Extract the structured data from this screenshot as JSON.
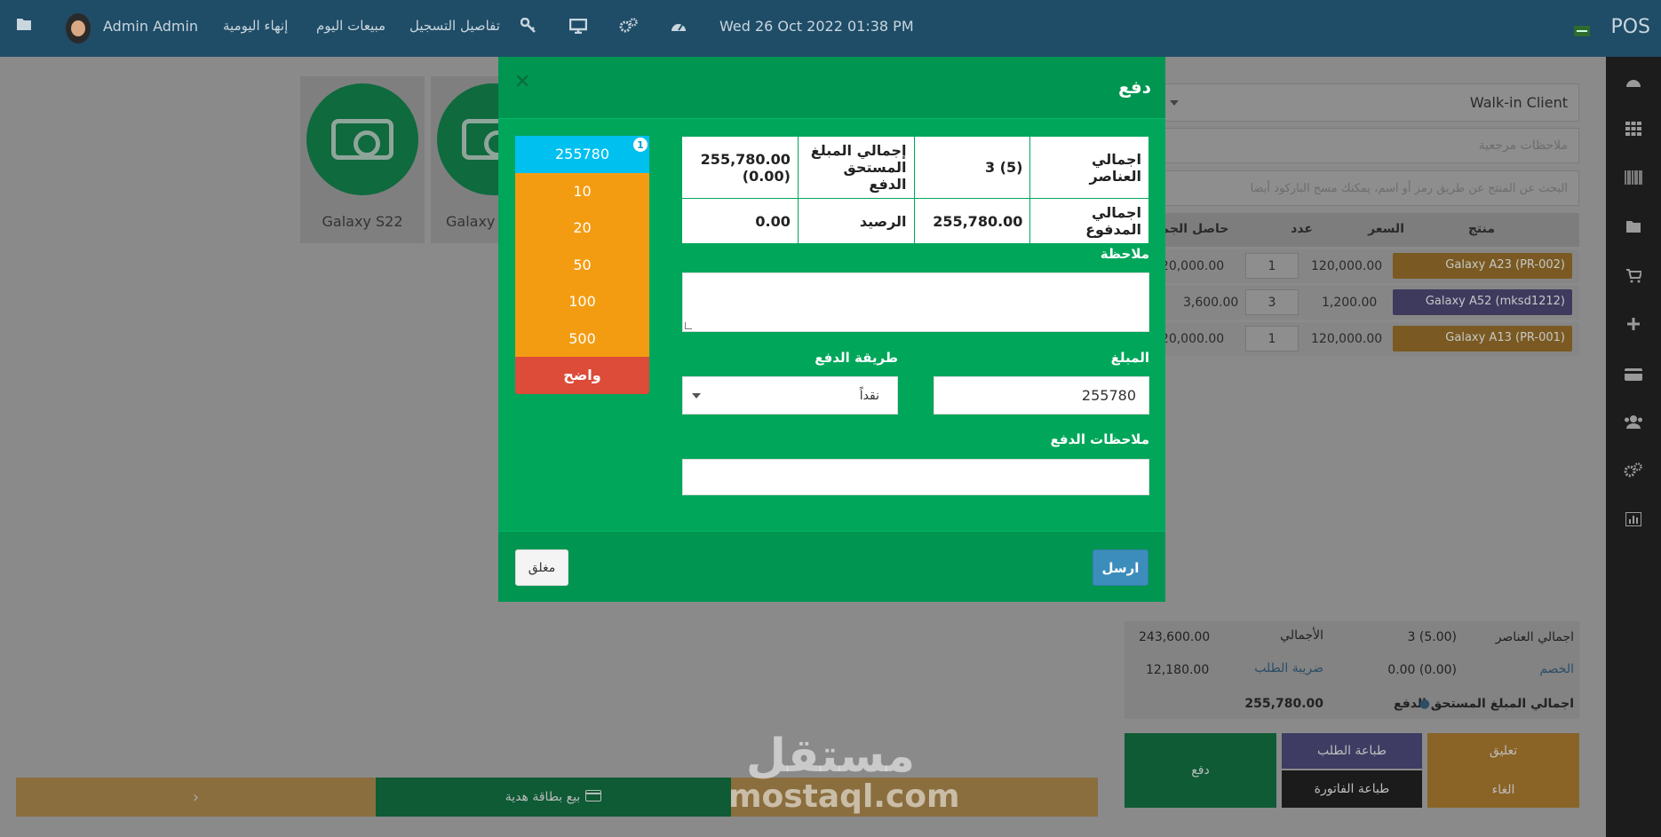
{
  "topbar": {
    "user_name": "Admin Admin",
    "end_of_day": "إنهاء اليومية",
    "today_sales": "مبيعات اليوم",
    "register_details": "تفاصيل التسجيل",
    "datetime": "Wed 26 Oct 2022 01:38 PM",
    "app_name": "POS"
  },
  "products": [
    {
      "name": "Galaxy S22"
    },
    {
      "name": "Galaxy"
    }
  ],
  "order": {
    "customer": "Walk-in Client",
    "reference_placeholder": "ملاحظات مرجعية",
    "search_placeholder": "البحث عن المنتج عن طريق رمز أو اسم، يمكنك مسح الباركود أيضا",
    "headers": {
      "product": "منتج",
      "price": "السعر",
      "qty": "عدد",
      "subtotal": "حاصل الجمع"
    },
    "items": [
      {
        "product": "Galaxy A23 (PR-002)",
        "price": "120,000.00",
        "qty": "1",
        "subtotal": "120,000.00",
        "color": "#7a5a22"
      },
      {
        "product": "Galaxy A52 (mksd1212)",
        "price": "1,200.00",
        "qty": "3",
        "subtotal": "3,600.00",
        "color": "#3d3a5e"
      },
      {
        "product": "Galaxy A13 (PR-001)",
        "price": "120,000.00",
        "qty": "1",
        "subtotal": "120,000.00",
        "color": "#7a5a22"
      }
    ],
    "totals": {
      "items_label": "اجمالي العناصر",
      "items_value": "3 (5.00)",
      "total_label": "الأجمالي",
      "total_value": "243,600.00",
      "discount_label": "الخصم",
      "discount_value": "0.00 (0.00)",
      "tax_label": "ضريبة الطلب",
      "tax_value": "12,180.00",
      "payable_label": "اجمالي المبلغ المستحق الدفع",
      "payable_value": "255,780.00"
    },
    "actions": {
      "suspend": "تعليق",
      "cancel": "الغاء",
      "print_order": "طباعة الطلب",
      "print_bill": "طباعة الفاتورة",
      "pay": "دفع"
    }
  },
  "bottom": {
    "gift_card": "بيع بطاقة هدية"
  },
  "watermark": {
    "ar": "مستقل",
    "en": "mostaql.com"
  },
  "modal": {
    "title": "دفع",
    "quick_cash": [
      "255780",
      "10",
      "20",
      "50",
      "100",
      "500"
    ],
    "quick_badge": "1",
    "clear": "واضح",
    "summary": {
      "total_items_label": "اجمالي العناصر",
      "total_items_value": "3 (5)",
      "total_payable_label": "إجمالي المبلغ المستحق الدفع",
      "total_payable_value": "255,780.00 (0.00)",
      "total_paid_label": "اجمالي المدفوع",
      "total_paid_value": "255,780.00",
      "balance_label": "الرصيد",
      "balance_value": "0.00"
    },
    "note_label": "ملاحظة",
    "amount_label": "المبلغ",
    "amount_value": "255780",
    "method_label": "طريقة الدفع",
    "method_value": "نقداً",
    "payment_note_label": "ملاحظات الدفع",
    "close_button": "مغلق",
    "submit_button": "ارسل"
  }
}
